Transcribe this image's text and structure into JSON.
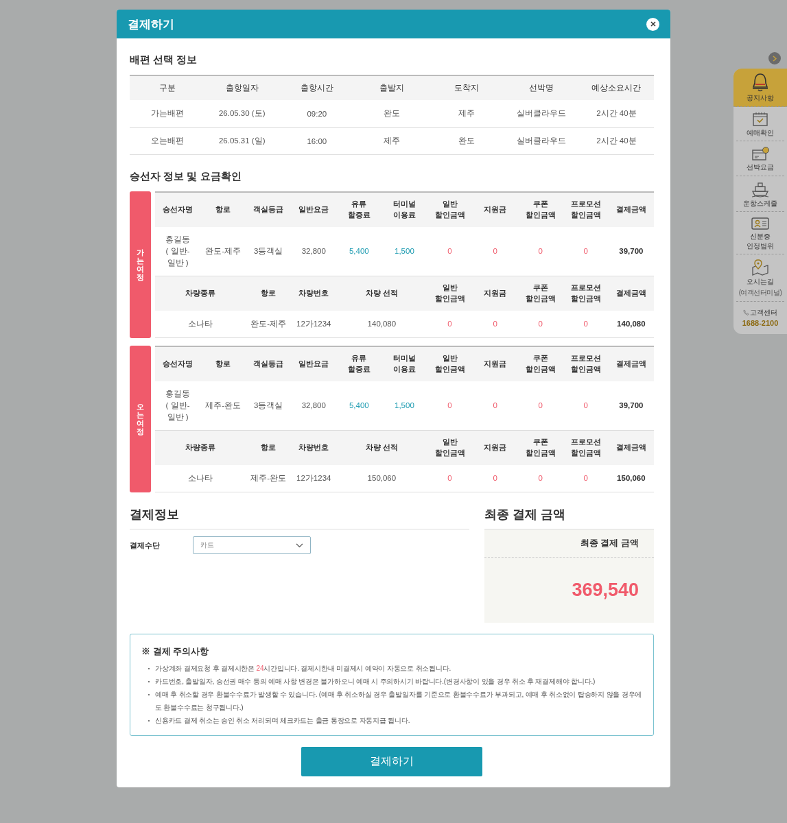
{
  "modal": {
    "title": "결제하기"
  },
  "voyage_info": {
    "title": "배편 선택 정보",
    "columns": [
      "구분",
      "출항일자",
      "출항시간",
      "출발지",
      "도착지",
      "선박명",
      "예상소요시간"
    ],
    "rows": [
      [
        "가는배편",
        "26.05.30 (토)",
        "09:20",
        "완도",
        "제주",
        "실버클라우드",
        "2시간 40분"
      ],
      [
        "오는배편",
        "26.05.31 (일)",
        "16:00",
        "제주",
        "완도",
        "실버클라우드",
        "2시간 40분"
      ]
    ]
  },
  "fare_check": {
    "title": "승선자 정보 및 요금확인",
    "legs": [
      {
        "label": "가는여정",
        "passenger_columns": [
          "승선자명",
          "항로",
          "객실등급",
          "일반요금",
          "유류\n할증료",
          "터미널\n이용료",
          "일반\n할인금액",
          "지원금",
          "쿠폰\n할인금액",
          "프로모션\n할인금액",
          "결제금액"
        ],
        "passenger_row": [
          {
            "text": "홍길동\n( 일반-\n일반 )",
            "kind": "plain"
          },
          {
            "text": "완도-제주",
            "kind": "plain"
          },
          {
            "text": "3등객실",
            "kind": "plain"
          },
          {
            "text": "32,800",
            "kind": "plain"
          },
          {
            "text": "5,400",
            "kind": "surcharge"
          },
          {
            "text": "1,500",
            "kind": "surcharge"
          },
          {
            "text": "0",
            "kind": "discount"
          },
          {
            "text": "0",
            "kind": "discount"
          },
          {
            "text": "0",
            "kind": "discount"
          },
          {
            "text": "0",
            "kind": "discount"
          },
          {
            "text": "39,700",
            "kind": "total"
          }
        ],
        "vehicle_columns": [
          "차량종류",
          "항로",
          "차량번호",
          "차량 선적",
          "일반\n할인금액",
          "지원금",
          "쿠폰\n할인금액",
          "프로모션\n할인금액",
          "결제금액"
        ],
        "vehicle_row": [
          {
            "text": "소나타",
            "kind": "plain"
          },
          {
            "text": "완도-제주",
            "kind": "plain"
          },
          {
            "text": "12가1234",
            "kind": "plain"
          },
          {
            "text": "140,080",
            "kind": "plain"
          },
          {
            "text": "0",
            "kind": "discount"
          },
          {
            "text": "0",
            "kind": "discount"
          },
          {
            "text": "0",
            "kind": "discount"
          },
          {
            "text": "0",
            "kind": "discount"
          },
          {
            "text": "140,080",
            "kind": "total"
          }
        ]
      },
      {
        "label": "오는여정",
        "passenger_columns": [
          "승선자명",
          "항로",
          "객실등급",
          "일반요금",
          "유류\n할증료",
          "터미널\n이용료",
          "일반\n할인금액",
          "지원금",
          "쿠폰\n할인금액",
          "프로모션\n할인금액",
          "결제금액"
        ],
        "passenger_row": [
          {
            "text": "홍길동\n( 일반-\n일반 )",
            "kind": "plain"
          },
          {
            "text": "제주-완도",
            "kind": "plain"
          },
          {
            "text": "3등객실",
            "kind": "plain"
          },
          {
            "text": "32,800",
            "kind": "plain"
          },
          {
            "text": "5,400",
            "kind": "surcharge"
          },
          {
            "text": "1,500",
            "kind": "surcharge"
          },
          {
            "text": "0",
            "kind": "discount"
          },
          {
            "text": "0",
            "kind": "discount"
          },
          {
            "text": "0",
            "kind": "discount"
          },
          {
            "text": "0",
            "kind": "discount"
          },
          {
            "text": "39,700",
            "kind": "total"
          }
        ],
        "vehicle_columns": [
          "차량종류",
          "항로",
          "차량번호",
          "차량 선적",
          "일반\n할인금액",
          "지원금",
          "쿠폰\n할인금액",
          "프로모션\n할인금액",
          "결제금액"
        ],
        "vehicle_row": [
          {
            "text": "소나타",
            "kind": "plain"
          },
          {
            "text": "제주-완도",
            "kind": "plain"
          },
          {
            "text": "12가1234",
            "kind": "plain"
          },
          {
            "text": "150,060",
            "kind": "plain"
          },
          {
            "text": "0",
            "kind": "discount"
          },
          {
            "text": "0",
            "kind": "discount"
          },
          {
            "text": "0",
            "kind": "discount"
          },
          {
            "text": "0",
            "kind": "discount"
          },
          {
            "text": "150,060",
            "kind": "total"
          }
        ]
      }
    ]
  },
  "payment_info": {
    "title": "결제정보",
    "method_label": "결제수단",
    "method_value": "카드"
  },
  "final_amount": {
    "title": "최종 결제 금액",
    "label": "최종 결제 금액",
    "amount": "369,540"
  },
  "notice": {
    "title": "※ 결제 주의사항",
    "items": [
      [
        {
          "text": "가상계좌 결제요청 후 결제시한은 ",
          "kind": "plain"
        },
        {
          "text": "24",
          "kind": "highlight"
        },
        {
          "text": "시간입니다. 결제시한내 미결제시 예약이 자동으로 취소됩니다.",
          "kind": "plain"
        }
      ],
      [
        {
          "text": "카드번호, 출발일자, 승선권 매수 등의 예매 사항 변경은 불가하오니 예매 시 주의하시기 바랍니다.(변경사항이 있을 경우 취소 후 재결제해야 합니다.)",
          "kind": "plain"
        }
      ],
      [
        {
          "text": "예매 후 취소할 경우 환불수수료가 발생할 수 있습니다. (예매 후 취소하실 경우 출발일자를 기준으로 환불수수료가 부과되고, 예매 후 취소없이 탑승하지 않을 경우에도 환불수수료는 청구됩니다.)",
          "kind": "plain"
        }
      ],
      [
        {
          "text": "신용카드 결제 취소는 승인 취소 처리되며 체크카드는 출금 통장으로 자동지급 됩니다.",
          "kind": "plain"
        }
      ]
    ]
  },
  "pay_button": "결제하기",
  "quick_menu": {
    "items": [
      {
        "label": "공지사항",
        "selected": true
      },
      {
        "label": "예매확인",
        "selected": false
      },
      {
        "label": "선박요금",
        "selected": false
      },
      {
        "label": "운항스케줄",
        "selected": false
      },
      {
        "label": "신분증\n인정범위",
        "selected": false
      },
      {
        "label": "오시는길",
        "sublabel": "(여객선터미널)",
        "selected": false
      }
    ],
    "contact_label": "고객센터",
    "contact_number": "1688-2100"
  }
}
